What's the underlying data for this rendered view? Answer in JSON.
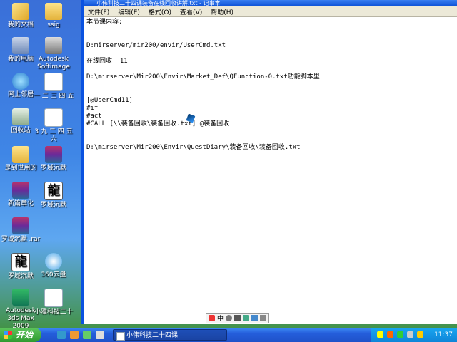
{
  "desktop_icons": [
    {
      "label": "我的文档",
      "icon": "documents-icon"
    },
    {
      "label": "我的电脑",
      "icon": "computer-icon"
    },
    {
      "label": "网上邻居",
      "icon": "network-icon"
    },
    {
      "label": "回收站",
      "icon": "recycle-bin-icon"
    },
    {
      "label": "是到世用的",
      "icon": "folder-icon"
    },
    {
      "label": "新篇章化",
      "icon": "archive-icon"
    },
    {
      "label": "罗域沉默 .rar",
      "icon": "archive-icon"
    },
    {
      "label": "罗域沉默",
      "icon": "dragon-icon"
    },
    {
      "label": "Autodesk 3ds Max 2009",
      "icon": "3dsmax-icon"
    },
    {
      "label": "ssig",
      "icon": "folder-icon"
    },
    {
      "label": "Autodesk Softimage",
      "icon": "autocad-icon"
    },
    {
      "label": "一 二 三 四 五",
      "icon": "text-file-icon"
    },
    {
      "label": "3 九 二 四 五 六",
      "icon": "text-file-icon"
    },
    {
      "label": "罗域沉默",
      "icon": "dragon-icon"
    },
    {
      "label": "罗域沉默",
      "icon": "dragon-icon"
    },
    {
      "label": "360云盘",
      "icon": "cloud-icon"
    },
    {
      "label": "小雅科技二十",
      "icon": "text-file-icon"
    }
  ],
  "window": {
    "title": "小伟科技二十四课装备在线回收讲解.txt - 记事本",
    "menu": [
      "文件(F)",
      "编辑(E)",
      "格式(O)",
      "查看(V)",
      "帮助(H)"
    ],
    "lines": [
      "本节课内容:",
      "",
      "",
      "D:mirserver/mir200/envir/UserCmd.txt",
      "",
      "在线回收  11",
      "",
      "D:\\mirserver\\Mir200\\Envir\\Market_Def\\QFunction-0.txt功能脚本里",
      "",
      "",
      "[@UserCmd11]",
      "#if",
      "#act",
      "#CALL [\\\\装备回收\\装备回收.txt] @装备回收",
      "",
      "",
      "D:\\mirserver\\Mir200\\Envir\\QuestDiary\\装备回收\\装备回收.txt"
    ]
  },
  "ime": {
    "label": "中"
  },
  "taskbar": {
    "start_label": "开始",
    "task_label": "小伟科技二十四课",
    "clock": "11:37"
  }
}
